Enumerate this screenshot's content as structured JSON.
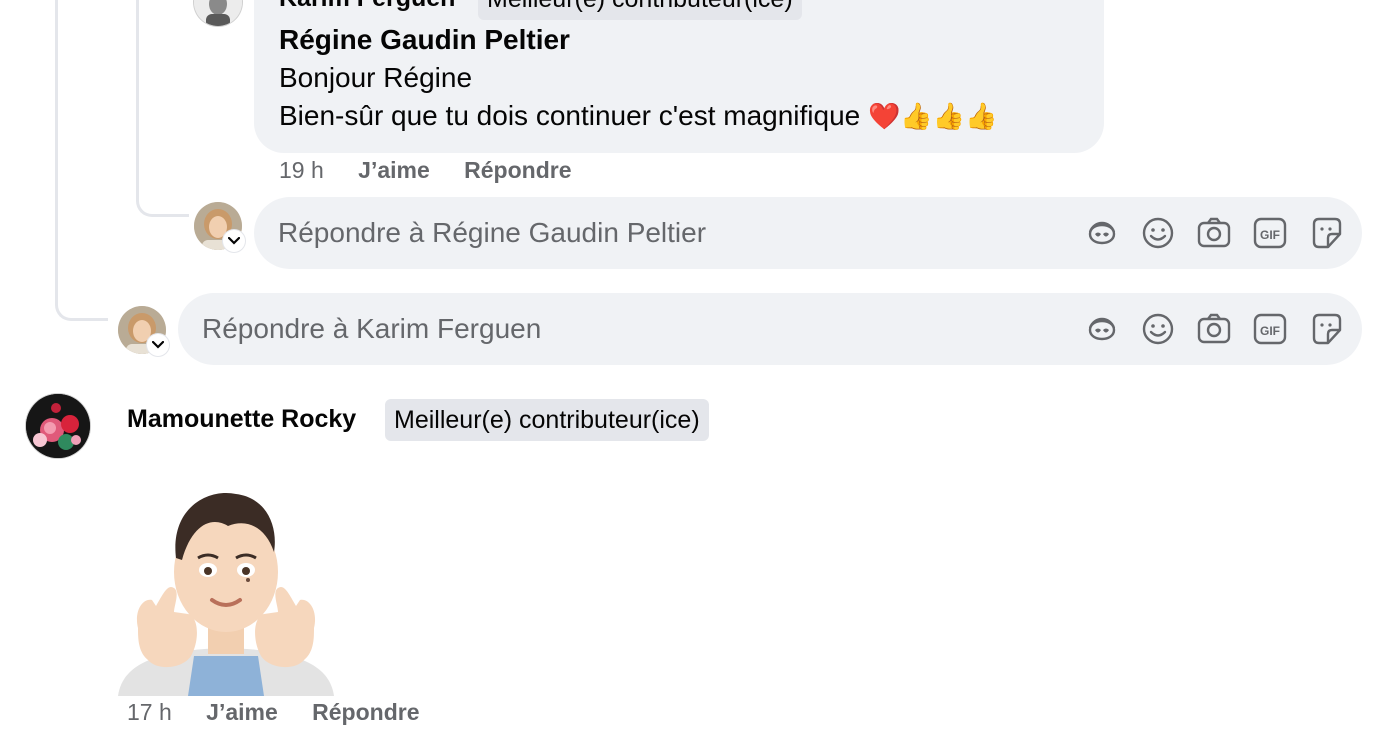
{
  "thread": {
    "top_author": "Karim Ferguen",
    "top_badge": "Meilleur(e) contributeur(ice)",
    "reply_comment": {
      "mention": "Régine Gaudin Peltier",
      "lines": [
        "Bonjour Régine",
        "Bien-sûr que tu dois continuer c'est magnifique"
      ],
      "emojis": "❤️👍👍👍",
      "time": "19 h",
      "like_label": "J’aime",
      "reply_label": "Répondre"
    },
    "reply_box_1_placeholder": "Répondre à Régine Gaudin Peltier",
    "reply_box_2_placeholder": "Répondre à Karim Ferguen"
  },
  "comment2": {
    "author": "Mamounette Rocky",
    "badge": "Meilleur(e) contributeur(ice)",
    "time": "17 h",
    "like_label": "J’aime",
    "reply_label": "Répondre"
  },
  "composer_icons": [
    "avatar-sticker-icon",
    "emoji-icon",
    "camera-icon",
    "gif-icon",
    "sticker-icon"
  ],
  "colors": {
    "bubble_bg": "#f0f2f5",
    "badge_bg": "#e4e6eb",
    "meta_text": "#65676b",
    "thread_line": "#e4e6eb"
  }
}
